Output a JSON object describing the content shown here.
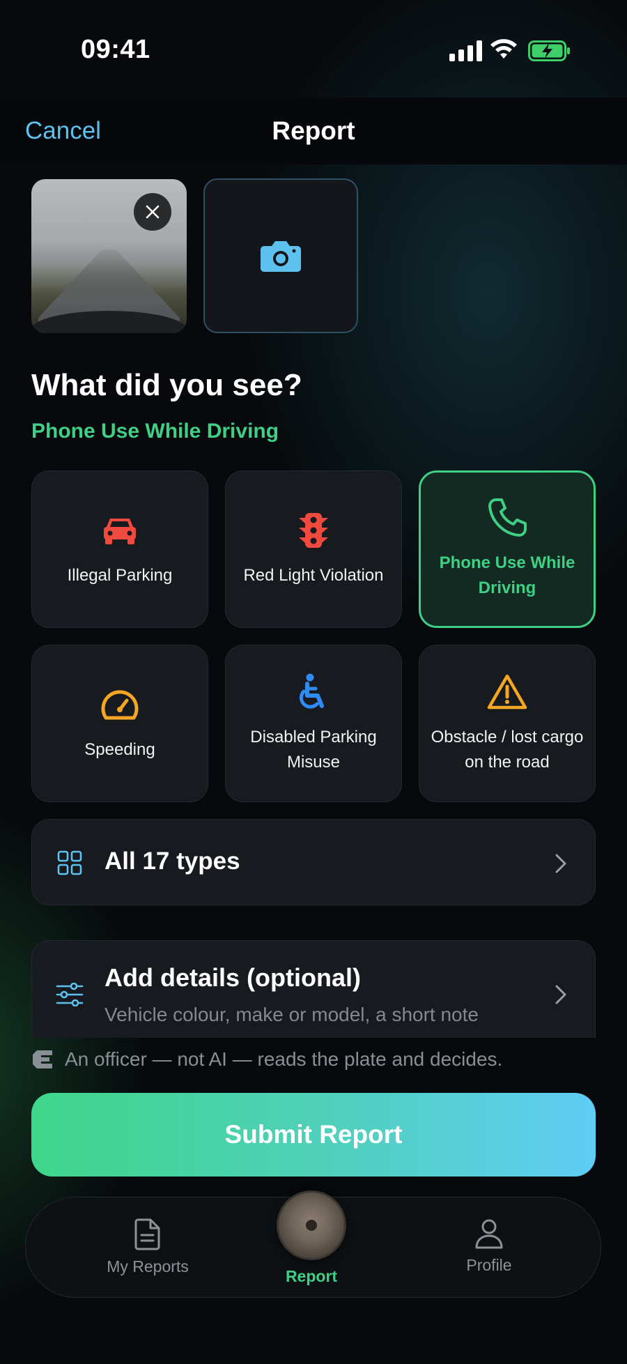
{
  "status": {
    "time": "09:41"
  },
  "nav": {
    "cancel_label": "Cancel",
    "title": "Report"
  },
  "photos": {
    "remove_icon": "close-icon",
    "add_icon": "camera-icon"
  },
  "question": "What did you see?",
  "selected_type": "Phone Use While Driving",
  "types": [
    {
      "label": "Illegal Parking",
      "icon": "car-icon",
      "color": "#f04a3f",
      "selected": false
    },
    {
      "label": "Red Light Violation",
      "icon": "traffic-light-icon",
      "color": "#f04a3f",
      "selected": false
    },
    {
      "label": "Phone Use While Driving",
      "icon": "phone-icon",
      "color": "#3fcf85",
      "selected": true
    },
    {
      "label": "Speeding",
      "icon": "speedometer-icon",
      "color": "#f5a623",
      "selected": false
    },
    {
      "label": "Disabled Parking Misuse",
      "icon": "wheelchair-icon",
      "color": "#2f8cf5",
      "selected": false
    },
    {
      "label": "Obstacle / lost cargo on the road",
      "icon": "warning-icon",
      "color": "#f5a623",
      "selected": false
    }
  ],
  "all_types": {
    "label": "All 17 types",
    "icon": "grid-icon"
  },
  "details": {
    "title": "Add details (optional)",
    "subtitle": "Vehicle colour, make or model, a short note",
    "icon": "sliders-icon"
  },
  "officer_note": "An officer — not AI — reads the plate and decides.",
  "submit_label": "Submit Report",
  "tabs": [
    {
      "label": "My Reports",
      "icon": "document-icon",
      "active": false
    },
    {
      "label": "Report",
      "icon": "report-knob-icon",
      "active": true
    },
    {
      "label": "Profile",
      "icon": "person-icon",
      "active": false
    }
  ],
  "colors": {
    "accent_green": "#3fcf85",
    "accent_blue": "#5ec2f0",
    "danger": "#f04a3f",
    "warning": "#f5a623"
  }
}
